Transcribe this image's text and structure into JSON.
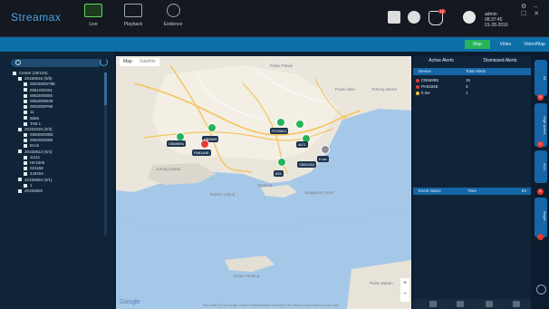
{
  "app": {
    "logo": "Streamax"
  },
  "nav": [
    {
      "label": "Live",
      "icon": "monitor-icon"
    },
    {
      "label": "Playback",
      "icon": "play-icon"
    },
    {
      "label": "Evidence",
      "icon": "evidence-icon"
    }
  ],
  "topbar": {
    "notification_count": "10",
    "user_name": "admin",
    "time": "08:37:45",
    "date": "01-28-2016"
  },
  "view_tabs": [
    "Map",
    "Video",
    "Video/Map"
  ],
  "tree": {
    "search_placeholder": "",
    "items": [
      {
        "label": "Center (28/104)",
        "level": 0
      },
      {
        "label": "20150816 (0/8)",
        "level": 1
      },
      {
        "label": "0003000079E",
        "level": 2
      },
      {
        "label": "0061000251",
        "level": 2
      },
      {
        "label": "0082000055",
        "level": 2
      },
      {
        "label": "0082000E08",
        "level": 2
      },
      {
        "label": "0082000F86",
        "level": 2
      },
      {
        "label": "11",
        "level": 2
      },
      {
        "label": "5555",
        "level": 2
      },
      {
        "label": "TAB 1",
        "level": 2
      },
      {
        "label": "20151025 (0/3)",
        "level": 1
      },
      {
        "label": "005000008D",
        "level": 2
      },
      {
        "label": "0082000098",
        "level": 2
      },
      {
        "label": "Ervin",
        "level": 2
      },
      {
        "label": "20150813 (0/4)",
        "level": 1
      },
      {
        "label": "11111",
        "level": 2
      },
      {
        "label": "HK1606",
        "level": 2
      },
      {
        "label": "021158",
        "level": 2
      },
      {
        "label": "3J0404",
        "level": 2
      },
      {
        "label": "20150820 (0/1)",
        "level": 1
      },
      {
        "label": "1",
        "level": 2
      },
      {
        "label": "20150826",
        "level": 1
      }
    ]
  },
  "map": {
    "type_buttons": [
      "Map",
      "Satellite"
    ],
    "place_names": [
      "Pulau Ubin",
      "Tekong Island",
      "Jurong Island",
      "Bukom Island",
      "Sentosa",
      "Pulau Pawai",
      "Pulau Penang",
      "Pulau Batam",
      "Singapore Strait"
    ],
    "vehicles": [
      {
        "label": "CB6969U",
        "color": "green"
      },
      {
        "label": "CB6698",
        "color": "green"
      },
      {
        "label": "PA8184E",
        "color": "red"
      },
      {
        "label": "PC5983J",
        "color": "green"
      },
      {
        "label": "4671",
        "color": "green"
      },
      {
        "label": "CB6318U",
        "color": "green"
      },
      {
        "label": "h tse",
        "color": "gray"
      },
      {
        "label": "626",
        "color": "green"
      }
    ],
    "footer": "Map data ©2016 Google, Urban Redevelopment Authority   5 km   Terms of Use   Report a map error",
    "google": "Google"
  },
  "alerts": {
    "tabs": [
      "Active Alerts",
      "Dismissed Alerts"
    ],
    "columns": [
      "Device",
      "Total Alerts"
    ],
    "rows": [
      {
        "device": "CB6698S",
        "total": "15",
        "color": "#e53935"
      },
      {
        "device": "PA8184E",
        "total": "3",
        "color": "#e53935"
      },
      {
        "device": "h tse",
        "total": "1",
        "color": "#f9c02d"
      }
    ],
    "event_columns": [
      "Event Name",
      "Time",
      "Ev"
    ]
  },
  "side_tabs": [
    {
      "label": "All",
      "badge": ""
    },
    {
      "label": "High speed",
      "badge": "19"
    },
    {
      "label": "ACC",
      "badge": "0"
    },
    {
      "label": "Illegal ...",
      "badge": "4"
    }
  ]
}
